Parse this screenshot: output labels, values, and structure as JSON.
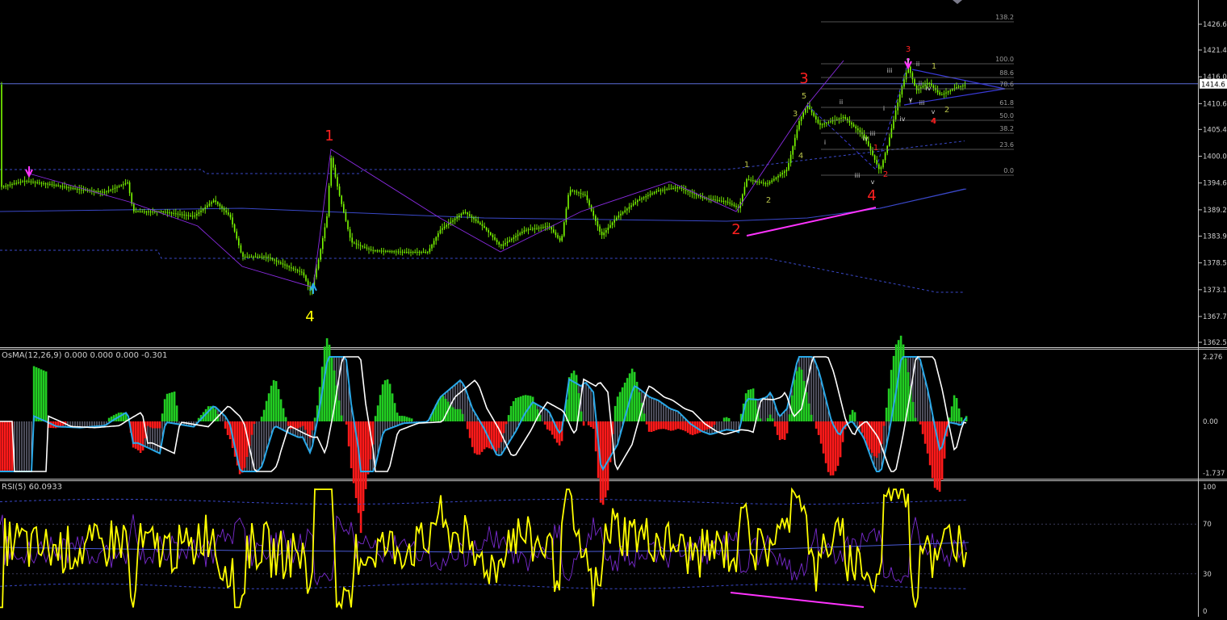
{
  "colors": {
    "background": "#000000",
    "bull_candle": "#7CFC00",
    "bear_candle": "#7CFC00",
    "wave_red": "#ff2020",
    "wave_yellow": "#ffff00",
    "wave_olive": "#b8c24a",
    "wave_white": "#d0d0d0",
    "fib_line": "#6e6e6e",
    "price_line": "#5b6cd9",
    "band_line": "#3a48c8",
    "magenta": "#ff33ff",
    "osma_up": "#22cc22",
    "osma_down": "#ff1a1a",
    "osma_hist_pale": "#d8dcff",
    "macd_line": "#29a8e8",
    "signal_line": "#ffffff",
    "rsi_line": "#ffff00",
    "rsi_purple": "#7a2bd1",
    "rsi_ma": "#4a5ad6",
    "axis_text": "#d0d0d0"
  },
  "price_pane": {
    "current_price": "1414.6",
    "y_axis_ticks": [
      "1426.6",
      "1421.4",
      "1416.0",
      "1410.6",
      "1405.4",
      "1400.0",
      "1394.6",
      "1389.2",
      "1383.9",
      "1378.5",
      "1373.1",
      "1367.7",
      "1362.5"
    ],
    "y_axis_range": [
      1362.5,
      1429.5
    ],
    "fib_levels": [
      "138.2",
      "100.0",
      "88.6",
      "78.6",
      "61.8",
      "50.0",
      "38.2",
      "23.6",
      "0.0"
    ],
    "wave_labels_big": [
      {
        "text": "4",
        "color": "wave_yellow"
      },
      {
        "text": "1",
        "color": "wave_red"
      },
      {
        "text": "2",
        "color": "wave_red"
      },
      {
        "text": "3",
        "color": "wave_red"
      },
      {
        "text": "4",
        "color": "wave_red"
      }
    ],
    "wave_labels_small": [
      {
        "text": "1",
        "color": "wave_olive"
      },
      {
        "text": "2",
        "color": "wave_olive"
      },
      {
        "text": "3",
        "color": "wave_olive"
      },
      {
        "text": "4",
        "color": "wave_olive"
      },
      {
        "text": "5",
        "color": "wave_olive"
      },
      {
        "text": "i",
        "color": "wave_white"
      },
      {
        "text": "ii",
        "color": "wave_white"
      },
      {
        "text": "iii",
        "color": "wave_white"
      },
      {
        "text": "iv",
        "color": "wave_white"
      },
      {
        "text": "v",
        "color": "wave_white"
      },
      {
        "text": "1",
        "color": "wave_red"
      },
      {
        "text": "2",
        "color": "wave_red"
      },
      {
        "text": "3",
        "color": "wave_red"
      },
      {
        "text": "4",
        "color": "wave_red"
      },
      {
        "text": "y",
        "color": "wave_white"
      },
      {
        "text": "ii",
        "color": "wave_white"
      },
      {
        "text": "iii",
        "color": "wave_white"
      },
      {
        "text": "i",
        "color": "wave_white"
      },
      {
        "text": "iv",
        "color": "wave_white"
      },
      {
        "text": "iii",
        "color": "wave_white"
      },
      {
        "text": "v",
        "color": "wave_white"
      },
      {
        "text": "iv",
        "color": "wave_white"
      },
      {
        "text": "v",
        "color": "wave_white"
      },
      {
        "text": "ii",
        "color": "wave_white"
      },
      {
        "text": "iii",
        "color": "wave_white"
      },
      {
        "text": "i",
        "color": "wave_white"
      },
      {
        "text": "1",
        "color": "wave_olive"
      },
      {
        "text": "2",
        "color": "wave_olive"
      },
      {
        "text": "4",
        "color": "wave_red"
      }
    ]
  },
  "osma_pane": {
    "label": "OsMA(12,26,9) 0.000 0.000 0.000 -0.301",
    "y_axis_ticks": [
      "2.276",
      "0.00",
      "-1.737"
    ]
  },
  "rsi_pane": {
    "label": "RSI(5) 60.0933",
    "y_axis_ticks": [
      "100",
      "70",
      "30",
      "0"
    ]
  },
  "chart_data": {
    "type": "line",
    "title": "",
    "note_series": [
      {
        "name": "OsMA(12,26,9)"
      },
      {
        "name": "RSI(5)"
      }
    ],
    "price_key_points": [
      {
        "label": "4",
        "price": 1373.5
      },
      {
        "label": "1",
        "price": 1401.5
      },
      {
        "label": "2",
        "price": 1388.5
      },
      {
        "label": "3",
        "price": 1410.5
      },
      {
        "label": "4",
        "price": 1396.5
      },
      {
        "label": "3",
        "price": 1418.5
      }
    ],
    "osma_range": [
      -1.737,
      2.276
    ],
    "rsi_levels": [
      70,
      30
    ]
  }
}
